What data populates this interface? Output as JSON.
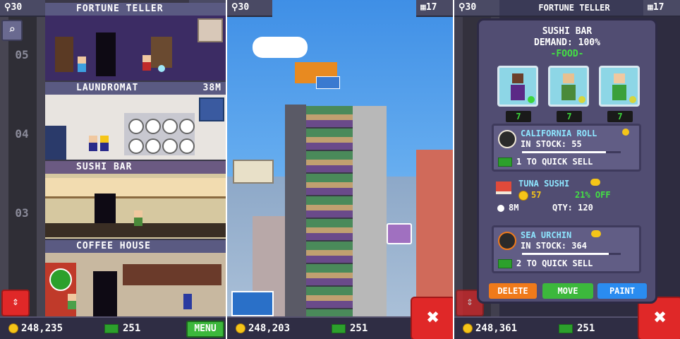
{
  "panels": [
    {
      "top_floor_count": "30",
      "top_right_count": "17",
      "floors": [
        {
          "label": "FORTUNE TELLER",
          "timer": ""
        },
        {
          "label": "LAUNDROMAT",
          "timer": "38M"
        },
        {
          "label": "SUSHI BAR",
          "timer": ""
        },
        {
          "label": "COFFEE HOUSE",
          "timer": ""
        }
      ],
      "floor_numbers": [
        "05",
        "04",
        "03"
      ],
      "coins": "248,235",
      "bux": "251",
      "menu_label": "MENU"
    },
    {
      "top_floor_count": "30",
      "top_right_count": "17",
      "coins": "248,203",
      "bux": "251"
    },
    {
      "top_floor_count": "30",
      "top_banner": "FORTUNE TELLER",
      "top_right_count": "17",
      "coins": "248,361",
      "bux": "251"
    }
  ],
  "popup": {
    "title": "SUSHI BAR",
    "demand": "DEMAND: 100%",
    "category": "-FOOD-",
    "avatars": [
      {
        "count": "7",
        "shirt": "#5b2a86",
        "skin": "#6b3f2a"
      },
      {
        "count": "7",
        "shirt": "#4a8a3a",
        "skin": "#e8c090"
      },
      {
        "count": "7",
        "shirt": "#3aa03a",
        "skin": "#f0c8a0"
      }
    ],
    "items": [
      {
        "name": "CALIFORNIA ROLL",
        "line2": "IN STOCK: 55",
        "line3": "1 TO QUICK SELL",
        "stock_fill": 0.85
      },
      {
        "name": "TUNA SUSHI",
        "price": "57",
        "discount": "21% OFF",
        "time": "8M",
        "qty": "QTY: 120"
      },
      {
        "name": "SEA URCHIN",
        "line2": "IN STOCK: 364",
        "line3": "2 TO QUICK SELL",
        "stock_fill": 0.88
      }
    ],
    "buttons": {
      "delete": "DELETE",
      "move": "MOVE",
      "paint": "PAINT"
    }
  },
  "colors": {
    "delete": "#f07a1a",
    "move": "#3cb83c",
    "paint": "#2a8cf0"
  }
}
